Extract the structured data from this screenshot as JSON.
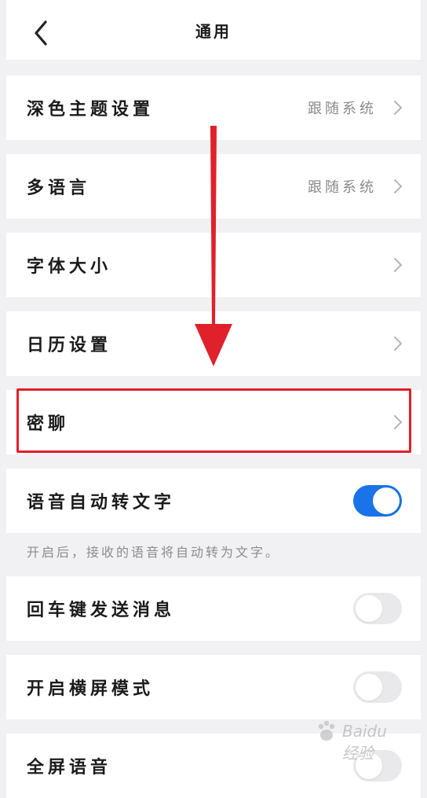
{
  "header": {
    "title": "通用"
  },
  "rows": [
    {
      "label": "深色主题设置",
      "value": "跟随系统"
    },
    {
      "label": "多语言",
      "value": "跟随系统"
    },
    {
      "label": "字体大小"
    },
    {
      "label": "日历设置"
    },
    {
      "label": "密聊"
    },
    {
      "label": "语音自动转文字",
      "toggle_on": true
    },
    {
      "label": "回车键发送消息",
      "toggle_on": false
    },
    {
      "label": "开启横屏模式",
      "toggle_on": false
    },
    {
      "label": "全屏语音"
    }
  ],
  "voice_hint": "开启后，接收的语音将自动转为文字。",
  "colors": {
    "toggle_on": "#1a73e8",
    "toggle_off": "#e9e9eb",
    "annotation": "#e0202a"
  },
  "watermark_text": "Baidu 经验"
}
